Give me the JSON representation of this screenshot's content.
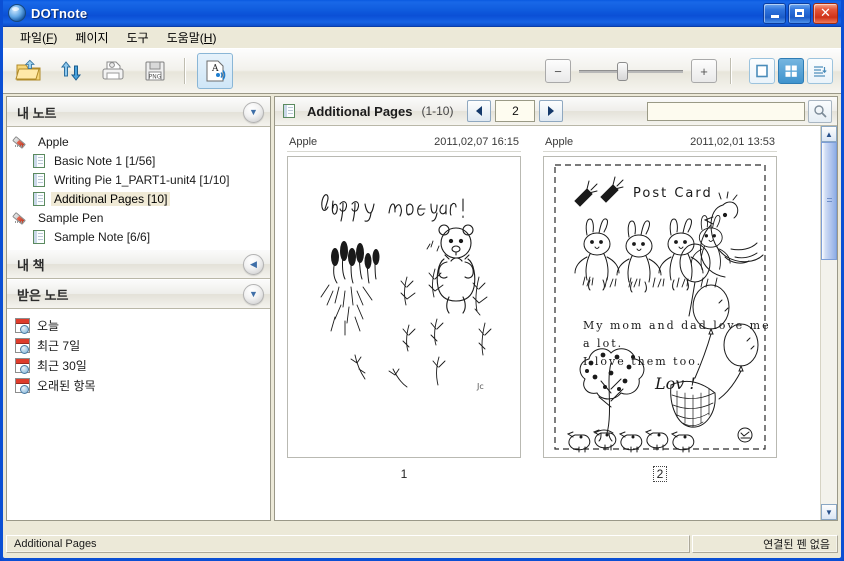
{
  "window": {
    "title": "DOTnote",
    "icon": "app-globe-icon",
    "minimize_label": "Minimize",
    "maximize_label": "Maximize",
    "close_label": "Close"
  },
  "menu": [
    {
      "label": "파일(F)",
      "text": "파일(",
      "mnemonic": "F",
      "tail": ")"
    },
    {
      "label": "페이지",
      "text": "페이지",
      "mnemonic": "",
      "tail": ""
    },
    {
      "label": "도구",
      "text": "도구",
      "mnemonic": "",
      "tail": ""
    },
    {
      "label": "도움말(H)",
      "text": "도움말(",
      "mnemonic": "H",
      "tail": ")"
    }
  ],
  "toolbar": {
    "buttons": [
      {
        "name": "open-folder-button",
        "icon": "folder-upload-icon",
        "active": false
      },
      {
        "name": "sync-button",
        "icon": "sync-arrows-icon",
        "active": false
      },
      {
        "name": "print-button",
        "icon": "printer-icon",
        "active": false
      },
      {
        "name": "export-png-button",
        "icon": "png-save-icon",
        "active": false
      },
      {
        "name": "text-recognition-button",
        "icon": "text-wireless-icon",
        "active": true
      }
    ],
    "zoom_out_label": "−",
    "zoom_in_label": "+",
    "view_modes": [
      {
        "name": "view-single",
        "selected": false
      },
      {
        "name": "view-grid",
        "selected": true
      },
      {
        "name": "view-list",
        "selected": false
      }
    ]
  },
  "sidebar": {
    "sections": [
      {
        "title": "내 노트",
        "chevron": "chevron-down-icon",
        "expanded": true
      },
      {
        "title": "내 책",
        "chevron": "chevron-left-icon",
        "expanded": false
      },
      {
        "title": "받은 노트",
        "chevron": "chevron-down-icon",
        "expanded": true
      }
    ],
    "tree": [
      {
        "label": "Apple",
        "type": "pen",
        "selected": false
      },
      {
        "label": "Basic Note 1 [1/56]",
        "type": "note",
        "selected": false
      },
      {
        "label": "Writing Pie 1_PART1-unit4 [1/10]",
        "type": "note",
        "selected": false
      },
      {
        "label": "Additional Pages [10]",
        "type": "note",
        "selected": true
      },
      {
        "label": "Sample Pen",
        "type": "pen",
        "selected": false
      },
      {
        "label": "Sample Note [6/6]",
        "type": "note",
        "selected": false
      }
    ],
    "dates": [
      {
        "label": "오늘"
      },
      {
        "label": "최근 7일"
      },
      {
        "label": "최근 30일"
      },
      {
        "label": "오래된 항목"
      }
    ]
  },
  "content": {
    "icon": "note-icon",
    "title": "Additional Pages",
    "range": "(1-10)",
    "prev_label": "Previous page",
    "next_label": "Next page",
    "page_value": "2",
    "search_value": "",
    "search_placeholder": "",
    "search_button": "search-icon",
    "thumbnails": [
      {
        "owner": "Apple",
        "timestamp": "2011,02,07 16:15",
        "page_number": "1",
        "focused": false,
        "drawing": "happy-new-year-lavender-bear-sketch",
        "handwriting": "Happy new year!"
      },
      {
        "owner": "Apple",
        "timestamp": "2011,02,01 13:53",
        "page_number": "2",
        "focused": true,
        "drawing": "post-card-bunnies-balloons-sketch",
        "handwriting": "Post Card / My mom and dad love me a lot. / I love them too. / Love !"
      }
    ]
  },
  "statusbar": {
    "left": "Additional Pages",
    "right": "연결된 펜 없음"
  },
  "colors": {
    "titlebar_blue": "#0b4fd6",
    "window_face": "#ece9d8",
    "selection": "#f0ead6",
    "accent": "#3f93cd"
  }
}
